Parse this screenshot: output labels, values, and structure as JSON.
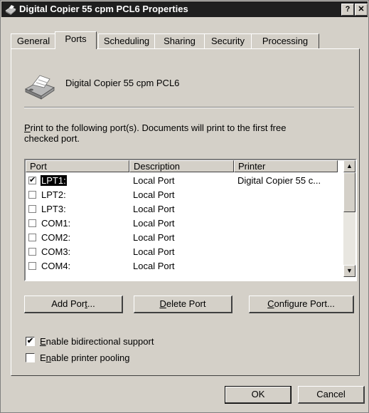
{
  "window": {
    "title": "Digital Copier 55 cpm PCL6 Properties",
    "help_label": "?",
    "close_label": "✕"
  },
  "tabs": [
    {
      "label": "General",
      "active": false
    },
    {
      "label": "Ports",
      "active": true
    },
    {
      "label": "Scheduling",
      "active": false
    },
    {
      "label": "Sharing",
      "active": false
    },
    {
      "label": "Security",
      "active": false
    },
    {
      "label": "Processing",
      "active": false
    }
  ],
  "ports_tab": {
    "printer_name": "Digital Copier 55 cpm PCL6",
    "instruction_rest1": "rint to the following port(s).  Documents will print to the first free",
    "instruction_rest2": "checked port.",
    "instruction_first": "P",
    "columns": [
      "Port",
      "Description",
      "Printer"
    ],
    "ports": [
      {
        "port": "LPT1:",
        "description": "Local Port",
        "printer": "Digital Copier 55 c...",
        "checked": true,
        "selected": true
      },
      {
        "port": "LPT2:",
        "description": "Local Port",
        "printer": "",
        "checked": false,
        "selected": false
      },
      {
        "port": "LPT3:",
        "description": "Local Port",
        "printer": "",
        "checked": false,
        "selected": false
      },
      {
        "port": "COM1:",
        "description": "Local Port",
        "printer": "",
        "checked": false,
        "selected": false
      },
      {
        "port": "COM2:",
        "description": "Local Port",
        "printer": "",
        "checked": false,
        "selected": false
      },
      {
        "port": "COM3:",
        "description": "Local Port",
        "printer": "",
        "checked": false,
        "selected": false
      },
      {
        "port": "COM4:",
        "description": "Local Port",
        "printer": "",
        "checked": false,
        "selected": false
      }
    ],
    "add_port": {
      "pre": "Add Por",
      "key": "t",
      "post": "..."
    },
    "delete_port": {
      "pre": "",
      "key": "D",
      "post": "elete Port"
    },
    "configure_port": {
      "pre": "",
      "key": "C",
      "post": "onfigure Port..."
    },
    "bidirectional": {
      "pre": "",
      "key": "E",
      "post": "nable bidirectional support",
      "checked": true
    },
    "pooling": {
      "pre": "E",
      "key": "n",
      "post": "able printer pooling",
      "checked": false
    }
  },
  "footer": {
    "ok_label": "OK",
    "cancel_label": "Cancel"
  }
}
